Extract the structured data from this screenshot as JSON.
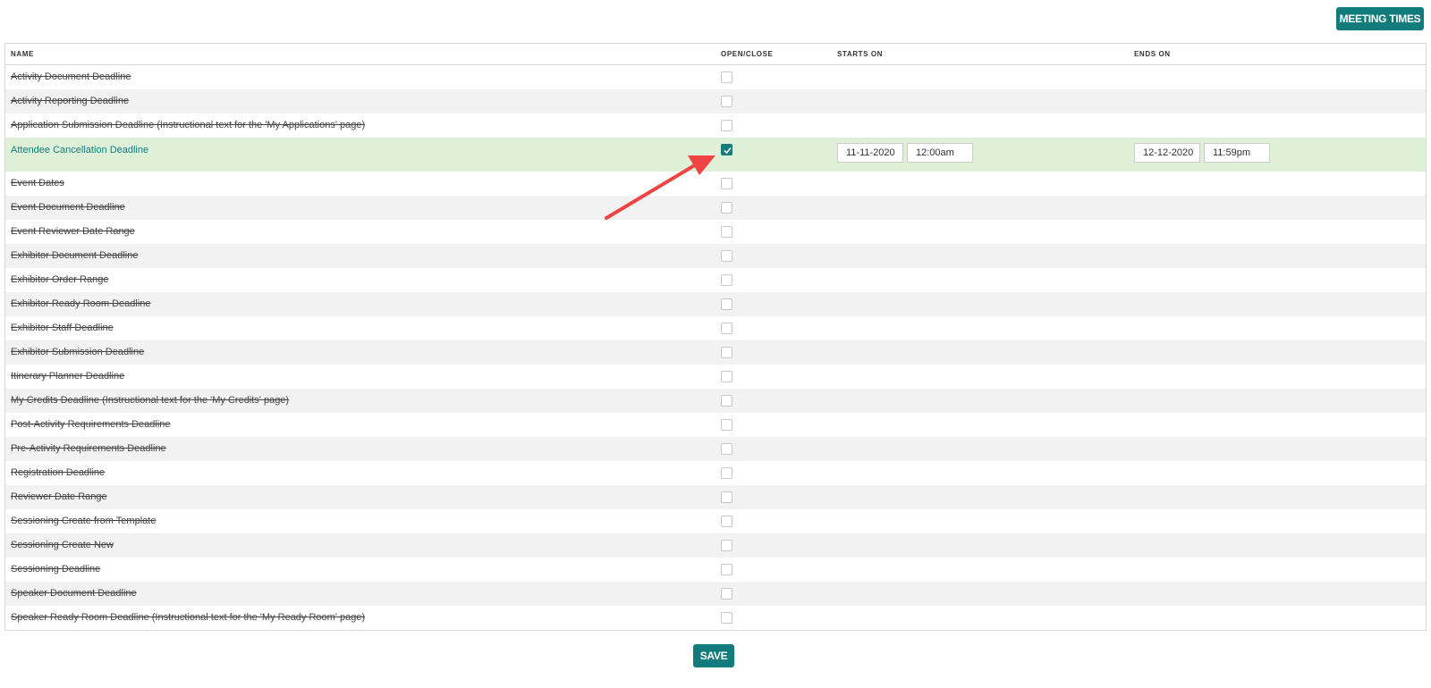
{
  "toolbar": {
    "meeting_times_label": "MEETING TIMES",
    "save_label": "SAVE"
  },
  "table": {
    "columns": {
      "name": "NAME",
      "open_close": "OPEN/CLOSE",
      "starts_on": "STARTS ON",
      "ends_on": "ENDS ON"
    },
    "rows": [
      {
        "name": "Activity Document Deadline",
        "checked": false
      },
      {
        "name": "Activity Reporting Deadline",
        "checked": false
      },
      {
        "name": "Application Submission Deadline (Instructional text for the 'My Applications' page)",
        "checked": false
      },
      {
        "name": "Attendee Cancellation Deadline",
        "checked": true,
        "start_date": "11-11-2020",
        "start_time": "12:00am",
        "end_date": "12-12-2020",
        "end_time": "11:59pm"
      },
      {
        "name": "Event Dates",
        "checked": false
      },
      {
        "name": "Event Document Deadline",
        "checked": false
      },
      {
        "name": "Event Reviewer Date Range",
        "checked": false
      },
      {
        "name": "Exhibitor Document Deadline",
        "checked": false
      },
      {
        "name": "Exhibitor Order Range",
        "checked": false
      },
      {
        "name": "Exhibitor Ready Room Deadline",
        "checked": false
      },
      {
        "name": "Exhibitor Staff Deadline",
        "checked": false
      },
      {
        "name": "Exhibitor Submission Deadline",
        "checked": false
      },
      {
        "name": "Itinerary Planner Deadline",
        "checked": false
      },
      {
        "name": "My Credits Deadline (Instructional text for the 'My Credits' page)",
        "checked": false
      },
      {
        "name": "Post-Activity Requirements Deadline",
        "checked": false
      },
      {
        "name": "Pre-Activity Requirements Deadline",
        "checked": false
      },
      {
        "name": "Registration Deadline",
        "checked": false
      },
      {
        "name": "Reviewer Date Range",
        "checked": false
      },
      {
        "name": "Sessioning Create from Template",
        "checked": false
      },
      {
        "name": "Sessioning Create New",
        "checked": false
      },
      {
        "name": "Sessioning Deadline",
        "checked": false
      },
      {
        "name": "Speaker Document Deadline",
        "checked": false
      },
      {
        "name": "Speaker Ready Room Deadline (Instructional text for the 'My Ready Room' page)",
        "checked": false
      }
    ]
  },
  "colors": {
    "accent": "#127c7c",
    "active_row": "#dff0d8",
    "arrow": "#ef4444",
    "alt_row": "#f2f2f2"
  }
}
